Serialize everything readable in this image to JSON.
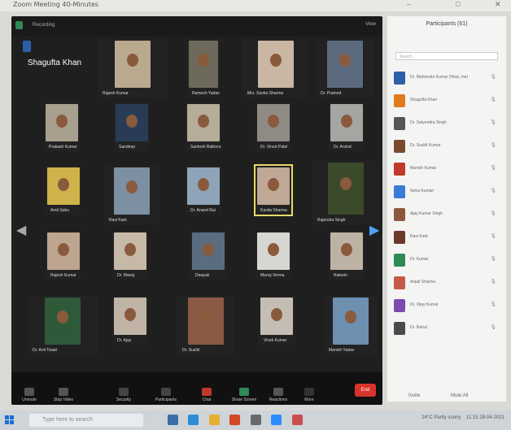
{
  "window": {
    "title": "Zoom Meeting 40-Minutes"
  },
  "topbar": {
    "meeting_label": "Recording",
    "view_label": "View"
  },
  "active_speaker": "Shagufta Khan",
  "tiles": [
    {
      "name": "Shagufta Khan"
    },
    {
      "name": "Rajesh Kumar"
    },
    {
      "name": "Ramesh Yadav"
    },
    {
      "name": "Mrs. Sunita Sharma"
    },
    {
      "name": "Dr. Pramod"
    },
    {
      "name": "Prakash Kumar"
    },
    {
      "name": "Sandeep"
    },
    {
      "name": "Santosh Rathore"
    },
    {
      "name": "Dr. Vinod Patel"
    },
    {
      "name": "Dr. Arvind"
    },
    {
      "name": "Amit Sahu"
    },
    {
      "name": "Ravi Kant"
    },
    {
      "name": "Dr. Anand Rai"
    },
    {
      "name": "Kavita Sharma"
    },
    {
      "name": "Rajendra Singh"
    },
    {
      "name": "Rajesh Kumar"
    },
    {
      "name": "Dr. Manoj"
    },
    {
      "name": "Deepak"
    },
    {
      "name": "Manoj Verma"
    },
    {
      "name": "Rakesh"
    },
    {
      "name": "Dr. Anil Tiwari"
    },
    {
      "name": "Dr. Ajay"
    },
    {
      "name": "Dr. Sushil"
    },
    {
      "name": "Vivek Kumar"
    },
    {
      "name": "Manish Yadav"
    }
  ],
  "toolbar": {
    "unmute": "Unmute",
    "stop_video": "Stop Video",
    "security": "Security",
    "participants": "Participants",
    "chat": "Chat",
    "share_screen": "Share Screen",
    "reactions": "Reactions",
    "more": "More",
    "end": "End"
  },
  "participants_panel": {
    "title": "Participants (61)",
    "search_placeholder": "Search",
    "items": [
      {
        "name": "Dr. Mahendra Kumar (Host, me)",
        "color": "#2d5fa8"
      },
      {
        "name": "Shagufta Khan",
        "color": "#e07b1f"
      },
      {
        "name": "Dr. Satyendra Singh",
        "color": "#555555"
      },
      {
        "name": "Dr. Sushil Kumar",
        "color": "#7a4a2e"
      },
      {
        "name": "Manish Kumar",
        "color": "#c0392b"
      },
      {
        "name": "Neha Kumari",
        "color": "#3a7bd5"
      },
      {
        "name": "Ajay Kumar Singh",
        "color": "#8b5a3c"
      },
      {
        "name": "Ravi Kant",
        "color": "#6b3a2a"
      },
      {
        "name": "Dr. Kumar",
        "color": "#2e8b57"
      },
      {
        "name": "Anjali Sharma",
        "color": "#c65a4a"
      },
      {
        "name": "Dr. Vijay Kumar",
        "color": "#7b4bb0"
      },
      {
        "name": "Dr. Rahul",
        "color": "#4a4a4a"
      }
    ],
    "invite": "Invite",
    "mute_all": "Mute All"
  },
  "taskbar": {
    "search_placeholder": "Type here to search",
    "weather": "24°C Partly sunny",
    "time": "11:15",
    "date": "28-04-2021"
  }
}
